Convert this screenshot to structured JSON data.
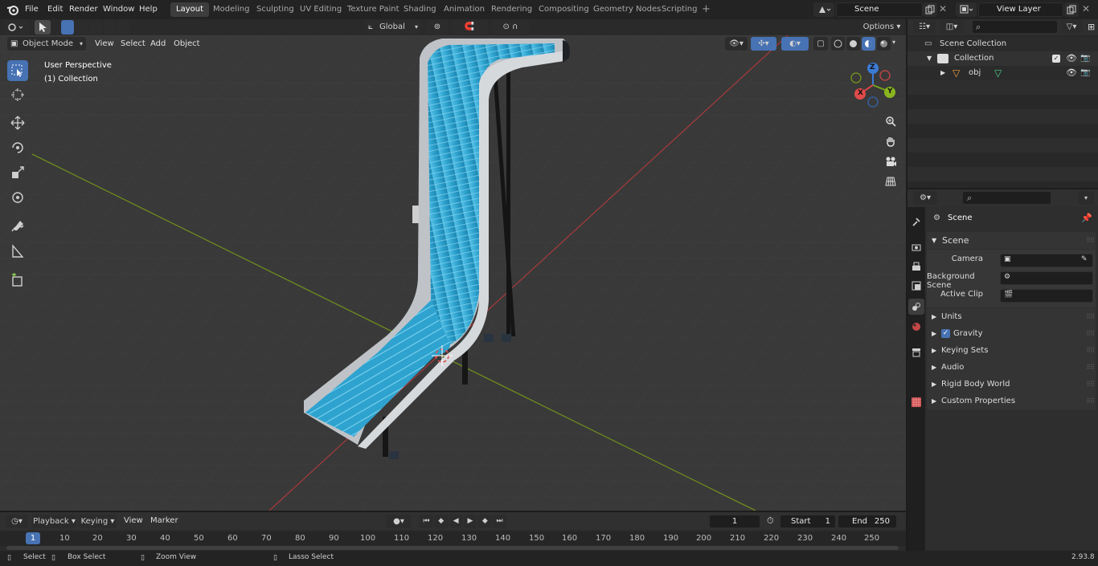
{
  "app": {
    "version": "2.93.8"
  },
  "menu": [
    "File",
    "Edit",
    "Render",
    "Window",
    "Help"
  ],
  "workspaces": [
    {
      "label": "Layout",
      "active": true
    },
    {
      "label": "Modeling",
      "active": false
    },
    {
      "label": "Sculpting",
      "active": false
    },
    {
      "label": "UV Editing",
      "active": false
    },
    {
      "label": "Texture Paint",
      "active": false
    },
    {
      "label": "Shading",
      "active": false
    },
    {
      "label": "Animation",
      "active": false
    },
    {
      "label": "Rendering",
      "active": false
    },
    {
      "label": "Compositing",
      "active": false
    },
    {
      "label": "Geometry Nodes",
      "active": false
    },
    {
      "label": "Scripting",
      "active": false
    }
  ],
  "add_workspace": "+",
  "scene_field": "Scene",
  "view_layer_field": "View Layer",
  "viewport": {
    "mode": "Object Mode",
    "menus": [
      "View",
      "Select",
      "Add",
      "Object"
    ],
    "orientation": "Global",
    "options": "Options",
    "overlay_title": "User Perspective",
    "overlay_collection": "(1) Collection",
    "gizmo": {
      "z": "Z",
      "y": "Y",
      "x": "X"
    }
  },
  "outliner": {
    "root": "Scene Collection",
    "collection": "Collection",
    "object": "obj"
  },
  "properties": {
    "context": "Scene",
    "panel": "Scene",
    "fields": [
      {
        "label": "Camera",
        "value": ""
      },
      {
        "label": "Background Scene",
        "value": ""
      },
      {
        "label": "Active Clip",
        "value": ""
      }
    ],
    "sections": [
      "Units",
      "Gravity",
      "Keying Sets",
      "Audio",
      "Rigid Body World",
      "Custom Properties"
    ],
    "gravity_checked": true
  },
  "timeline": {
    "menus": [
      "Playback",
      "Keying",
      "View",
      "Marker"
    ],
    "current_frame": "1",
    "start_label": "Start",
    "start": "1",
    "end_label": "End",
    "end": "250",
    "ticks": [
      "10",
      "20",
      "30",
      "40",
      "50",
      "60",
      "70",
      "80",
      "90",
      "100",
      "110",
      "120",
      "130",
      "140",
      "150",
      "160",
      "170",
      "180",
      "190",
      "200",
      "210",
      "220",
      "230",
      "240",
      "250"
    ],
    "playhead": "1"
  },
  "status": [
    "Select",
    "Box Select",
    "Zoom View",
    "Lasso Select"
  ],
  "colors": {
    "accent": "#4772b3",
    "belt": "#2fa3cf",
    "xaxis": "#a13a3a",
    "yaxis": "#6e8c1e"
  }
}
